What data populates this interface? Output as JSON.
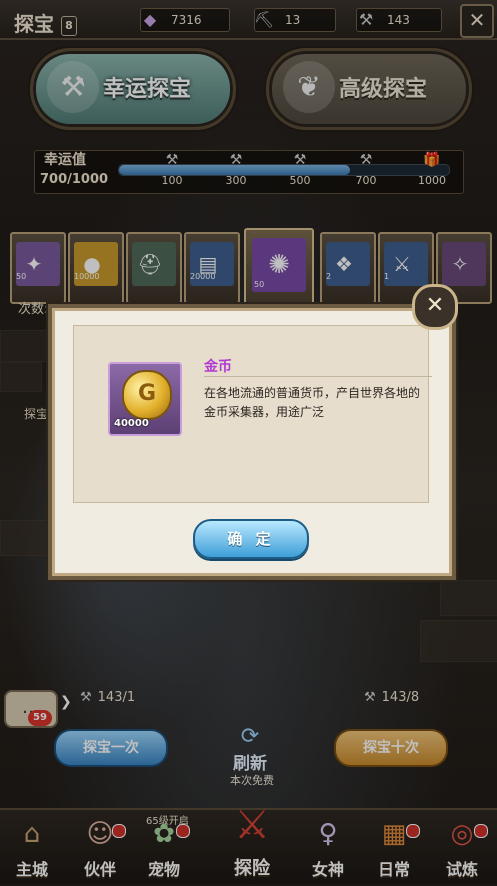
{
  "header": {
    "title": "探宝",
    "title_badge": "8",
    "close_glyph": "✕"
  },
  "resources": [
    {
      "icon": "gem-icon",
      "glyph": "◆",
      "value": "7316"
    },
    {
      "icon": "pickaxe-icon",
      "glyph": "⛏",
      "value": "13"
    },
    {
      "icon": "hammer-icon",
      "glyph": "⚒",
      "value": "143"
    }
  ],
  "tabs": {
    "lucky": {
      "label": "幸运探宝",
      "icon": "pickaxe-icon",
      "glyph": "⚒"
    },
    "advanced": {
      "label": "高级探宝",
      "icon": "leaf-icon",
      "glyph": "❦"
    }
  },
  "luck": {
    "label": "幸运值",
    "value": "700/1000",
    "progress": 0.7,
    "milestones": [
      "100",
      "300",
      "500",
      "700",
      "1000"
    ],
    "milestone_icons": [
      "⚒",
      "⚒",
      "⚒",
      "⚒",
      "🎁"
    ]
  },
  "cards": [
    {
      "qty": "50",
      "glyph": "✦",
      "color": "#7a5a9e"
    },
    {
      "qty": "10000",
      "glyph": "●",
      "color": "#c79a2b"
    },
    {
      "qty": "",
      "glyph": "⛑",
      "color": "#4f6b5a"
    },
    {
      "qty": "20000",
      "glyph": "▤",
      "color": "#3f5f8f"
    },
    {
      "qty": "50",
      "glyph": "✺",
      "color": "#7a4aa8"
    },
    {
      "qty": "2",
      "glyph": "❖",
      "color": "#3f5f8f"
    },
    {
      "qty": "1",
      "glyph": "⚔",
      "color": "#3f5f8f"
    },
    {
      "qty": "",
      "glyph": "✧",
      "color": "#6a4a7a"
    }
  ],
  "draw_count_label": "次数:1",
  "side_label": "探宝",
  "modal": {
    "item_name": "金币",
    "item_qty": "40000",
    "coin_glyph": "G",
    "description": "在各地流通的普通货币，产自世界各地的金币采集器，用途广泛",
    "confirm_label": "确 定",
    "close_glyph": "✕"
  },
  "actions": {
    "once_cost": "143/1",
    "ten_cost": "143/8",
    "once_label": "探宝一次",
    "ten_label": "探宝十次",
    "refresh_label": "刷新",
    "refresh_glyph": "⟳",
    "free_label": "本次免费"
  },
  "chat": {
    "badge": "59",
    "glyph": "…",
    "arrow": "❯"
  },
  "nav": {
    "level_hint": "65级开启",
    "items": [
      {
        "label": "主城",
        "glyph": "⌂",
        "dot": false
      },
      {
        "label": "伙伴",
        "glyph": "☺",
        "dot": true
      },
      {
        "label": "宠物",
        "glyph": "✿",
        "dot": true
      },
      {
        "label": "探险",
        "glyph": "⚔",
        "dot": false
      },
      {
        "label": "女神",
        "glyph": "♀",
        "dot": false
      },
      {
        "label": "日常",
        "glyph": "▦",
        "dot": true
      },
      {
        "label": "试炼",
        "glyph": "◎",
        "dot": true
      }
    ]
  }
}
